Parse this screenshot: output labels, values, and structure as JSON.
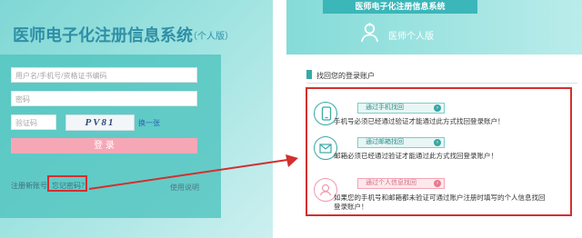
{
  "left": {
    "title": "医师电子化注册信息系统",
    "subtitle": "（个人版）",
    "username_placeholder": "用户名/手机号/资格证书编码",
    "password_placeholder": "密码",
    "captcha_placeholder": "验证码",
    "captcha_text": "PV81",
    "refresh_label": "换一张",
    "login_label": "登 录",
    "register_label": "注册新账号",
    "forgot_label": "忘记密码？",
    "help_label": "使用说明"
  },
  "right": {
    "title": "医师电子化注册信息系统",
    "subtitle": "医师个人版",
    "section_title": "找回您的登录账户",
    "methods": [
      {
        "label": "通过手机找回",
        "desc": "手机号必须已经通过验证才能通过此方式找回登录账户！",
        "icon": "phone-icon"
      },
      {
        "label": "通过邮箱找回",
        "desc": "邮箱必须已经通过验证才能通过此方式找回登录账户！",
        "icon": "mail-icon"
      },
      {
        "label": "通过个人信息找回",
        "desc_line1": "如果您的手机号和邮箱都未验证可通过账户注册时填写的个人信息找回",
        "desc_line2": "登录账户！",
        "icon": "person-icon"
      }
    ]
  },
  "colors": {
    "teal": "#52c4c0",
    "highlight_red": "#d32f2f",
    "login_pink": "#f6a7b6",
    "title_blue": "#2f8fa6"
  }
}
